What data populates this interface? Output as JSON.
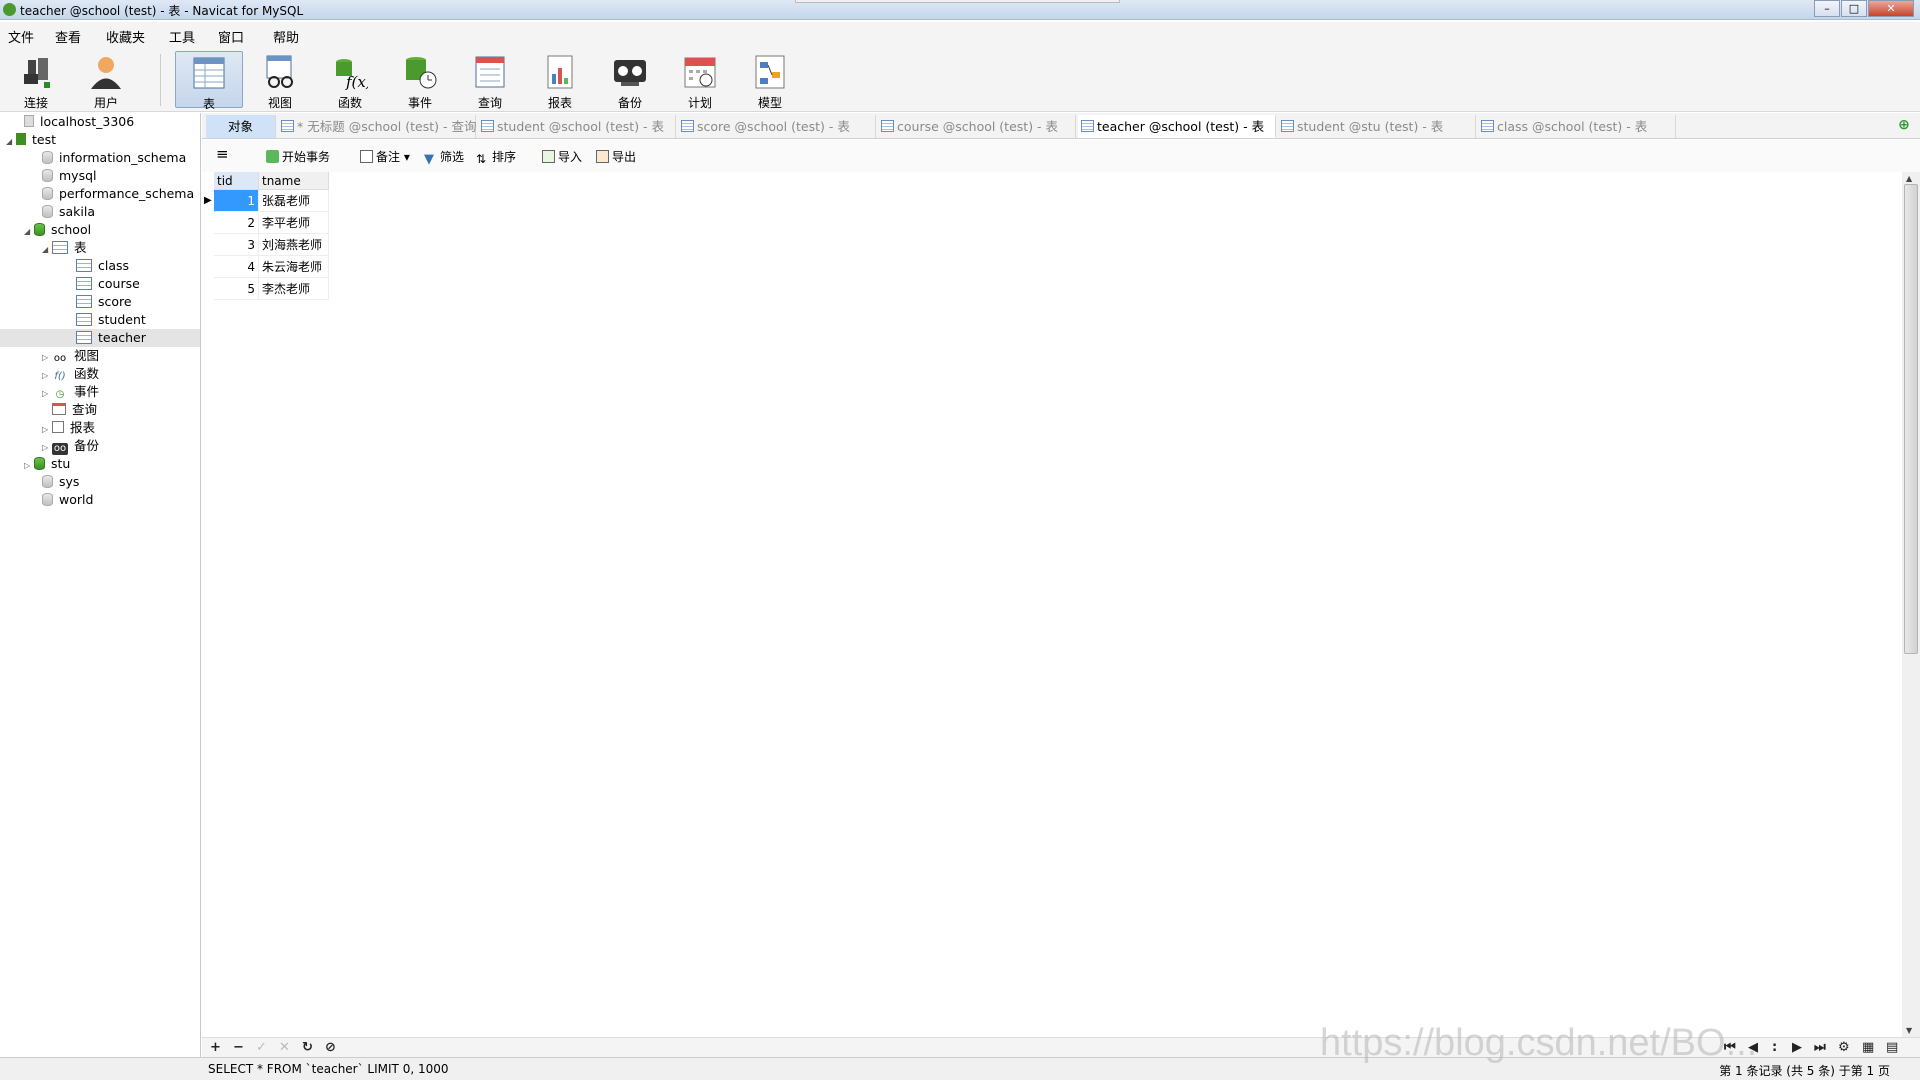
{
  "window": {
    "title": "teacher @school (test) - 表 - Navicat for MySQL"
  },
  "menu": [
    "文件",
    "查看",
    "收藏夹",
    "工具",
    "窗口",
    "帮助"
  ],
  "toolbar": [
    {
      "label": "连接",
      "icon": "plug-icon"
    },
    {
      "label": "用户",
      "icon": "user-icon"
    },
    {
      "label": "表",
      "icon": "table-icon"
    },
    {
      "label": "视图",
      "icon": "view-glasses-icon"
    },
    {
      "label": "函数",
      "icon": "function-icon"
    },
    {
      "label": "事件",
      "icon": "event-icon"
    },
    {
      "label": "查询",
      "icon": "query-icon"
    },
    {
      "label": "报表",
      "icon": "report-icon"
    },
    {
      "label": "备份",
      "icon": "backup-icon"
    },
    {
      "label": "计划",
      "icon": "calendar-icon"
    },
    {
      "label": "模型",
      "icon": "model-icon"
    }
  ],
  "tree": [
    {
      "label": "localhost_3306"
    },
    {
      "label": "test"
    },
    {
      "label": "information_schema"
    },
    {
      "label": "mysql"
    },
    {
      "label": "performance_schema"
    },
    {
      "label": "sakila"
    },
    {
      "label": "school"
    },
    {
      "label": "表"
    },
    {
      "label": "class"
    },
    {
      "label": "course"
    },
    {
      "label": "score"
    },
    {
      "label": "student"
    },
    {
      "label": "teacher"
    },
    {
      "label": "视图"
    },
    {
      "label": "函数"
    },
    {
      "label": "事件"
    },
    {
      "label": "查询"
    },
    {
      "label": "报表"
    },
    {
      "label": "备份"
    },
    {
      "label": "stu"
    },
    {
      "label": "sys"
    },
    {
      "label": "world"
    }
  ],
  "tabs": [
    {
      "label": "对象"
    },
    {
      "label": "* 无标题 @school (test) - 查询"
    },
    {
      "label": "student @school (test) - 表"
    },
    {
      "label": "score @school (test) - 表"
    },
    {
      "label": "course @school (test) - 表"
    },
    {
      "label": "teacher @school (test) - 表"
    },
    {
      "label": "student @stu (test) - 表"
    },
    {
      "label": "class @school (test) - 表"
    }
  ],
  "grid_toolbar": {
    "menu": "≡",
    "begin_tx": "开始事务",
    "note": "备注",
    "filter": "筛选",
    "sort": "排序",
    "import": "导入",
    "export": "导出"
  },
  "table": {
    "columns": [
      "tid",
      "tname"
    ],
    "rows": [
      {
        "tid": "1",
        "tname": "张磊老师"
      },
      {
        "tid": "2",
        "tname": "李平老师"
      },
      {
        "tid": "3",
        "tname": "刘海燕老师"
      },
      {
        "tid": "4",
        "tname": "朱云海老师"
      },
      {
        "tid": "5",
        "tname": "李杰老师"
      }
    ]
  },
  "bottom": {
    "add": "+",
    "remove": "−",
    "apply": "✓",
    "discard": "✕",
    "refresh": "↻",
    "stop": "⊘"
  },
  "status": {
    "sql": "SELECT * FROM `teacher` LIMIT 0, 1000",
    "records": "第 1 条记录 (共 5 条) 于第 1 页"
  },
  "watermark": "https://blog.csdn.net/BO..."
}
